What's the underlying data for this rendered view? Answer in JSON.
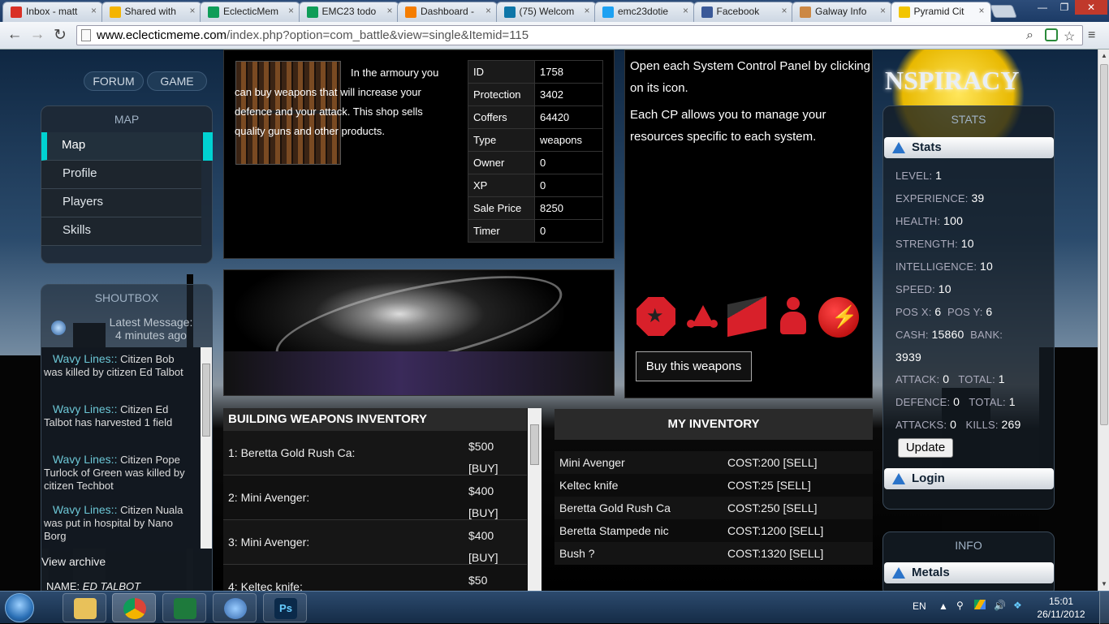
{
  "browser": {
    "tabs": [
      {
        "label": "Inbox - matt",
        "color": "#d93025"
      },
      {
        "label": "Shared with",
        "color": "#f4b400"
      },
      {
        "label": "EclecticMem",
        "color": "#0f9d58"
      },
      {
        "label": "EMC23 todo",
        "color": "#0f9d58"
      },
      {
        "label": "Dashboard -",
        "color": "#f57d00"
      },
      {
        "label": "(75) Welcom",
        "color": "#0e76a8"
      },
      {
        "label": "emc23dotie",
        "color": "#1da1f2"
      },
      {
        "label": "Facebook",
        "color": "#3b5998"
      },
      {
        "label": "Galway Info",
        "color": "#c84"
      },
      {
        "label": "Pyramid Cit",
        "color": "#f2c500"
      }
    ],
    "url_domain": "www.eclecticmeme.com",
    "url_path": "/index.php?option=com_battle&view=single&Itemid=115",
    "close_glyph": "×"
  },
  "site": {
    "pills": [
      "FORUM",
      "GAME"
    ],
    "logo_text": "NSPIRACY"
  },
  "map_panel": {
    "title": "MAP",
    "items": [
      "Map",
      "Profile",
      "Players",
      "Skills"
    ]
  },
  "shoutbox": {
    "title": "SHOUTBOX",
    "latest_label": "Latest Message:",
    "latest_time": "4 minutes ago",
    "messages": [
      {
        "user": "Wavy Lines::",
        "text": "Citizen Bob was killed by citizen Ed Talbot"
      },
      {
        "user": "Wavy Lines::",
        "text": "Citizen Ed Talbot has harvested 1 field"
      },
      {
        "user": "Wavy Lines::",
        "text": "Citizen Pope Turlock of Green was killed by citizen Techbot"
      },
      {
        "user": "Wavy Lines::",
        "text": "Citizen Nuala was put in hospital by Nano Borg"
      }
    ],
    "archive_link": "View archive",
    "name_label": "NAME:",
    "name_value": "ED TALBOT"
  },
  "shop": {
    "description": "In the armoury you can buy weapons that will increase your defence and your attack. This shop sells quality guns and other products.",
    "properties": [
      {
        "key": "ID",
        "value": "1758"
      },
      {
        "key": "Protection",
        "value": "3402"
      },
      {
        "key": "Coffers",
        "value": "64420"
      },
      {
        "key": "Type",
        "value": "weapons"
      },
      {
        "key": "Owner",
        "value": "0"
      },
      {
        "key": "XP",
        "value": "0"
      },
      {
        "key": "Sale Price",
        "value": "8250"
      },
      {
        "key": "Timer",
        "value": "0"
      }
    ]
  },
  "system_panel": {
    "line1": "Open each System Control Panel by clicking on its icon.",
    "line2": "Each CP allows you to manage your resources specific to each system.",
    "icons": [
      "star-octagon-icon",
      "molecule-icon",
      "box-icon",
      "person-icon",
      "lightning-icon"
    ],
    "buy_button": "Buy this weapons"
  },
  "building_inventory": {
    "title": "BUILDING WEAPONS INVENTORY",
    "buy_label": "[BUY]",
    "items": [
      {
        "name": "1: Beretta Gold Rush Ca:",
        "price": "$500"
      },
      {
        "name": "2: Mini Avenger:",
        "price": "$400"
      },
      {
        "name": "3: Mini Avenger:",
        "price": "$400"
      },
      {
        "name": "4: Keltec knife:",
        "price": "$50"
      }
    ]
  },
  "my_inventory": {
    "title": "MY INVENTORY",
    "sell_label": "[SELL]",
    "items": [
      {
        "name": "Mini Avenger",
        "cost": "COST:200"
      },
      {
        "name": "Keltec knife",
        "cost": "COST:25"
      },
      {
        "name": "Beretta Gold Rush Ca",
        "cost": "COST:250"
      },
      {
        "name": "Beretta Stampede nic",
        "cost": "COST:1200"
      },
      {
        "name": "Bush ?",
        "cost": "COST:1320"
      }
    ]
  },
  "stats": {
    "title": "STATS",
    "ribbon": "Stats",
    "level_label": "LEVEL:",
    "level": "1",
    "experience_label": "EXPERIENCE:",
    "experience": "39",
    "health_label": "HEALTH:",
    "health": "100",
    "strength_label": "STRENGTH:",
    "strength": "10",
    "intelligence_label": "INTELLIGENCE:",
    "intelligence": "10",
    "speed_label": "SPEED:",
    "speed": "10",
    "posx_label": "POS X:",
    "posx": "6",
    "posy_label": "POS Y:",
    "posy": "6",
    "cash_label": "CASH:",
    "cash": "15860",
    "bank_label": "BANK:",
    "bank": "3939",
    "attack_label": "ATTACK:",
    "attack": "0",
    "attack_total_label": "TOTAL:",
    "attack_total": "1",
    "defence_label": "DEFENCE:",
    "defence": "0",
    "defence_total_label": "TOTAL:",
    "defence_total": "1",
    "attacks_label": "ATTACKS:",
    "attacks": "0",
    "kills_label": "KILLS:",
    "kills": "269",
    "update_button": "Update",
    "login_ribbon": "Login"
  },
  "info": {
    "title": "INFO",
    "ribbon": "Metals"
  },
  "taskbar": {
    "language": "EN",
    "time": "15:01",
    "date": "26/11/2012"
  }
}
